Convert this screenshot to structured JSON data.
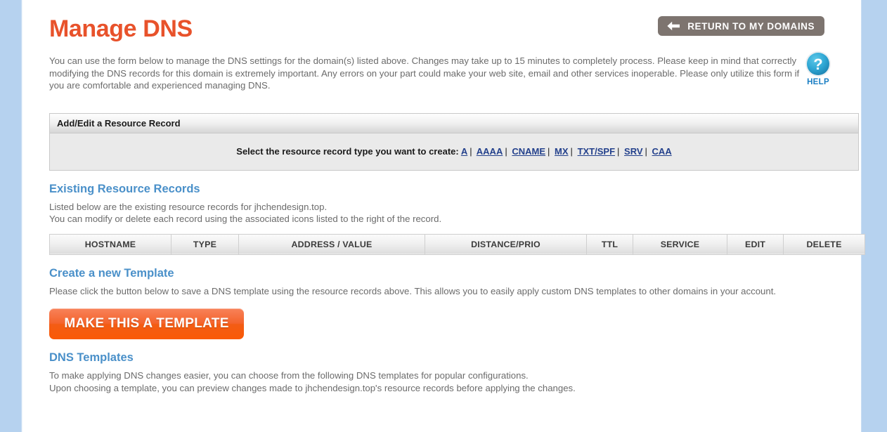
{
  "header": {
    "title": "Manage DNS",
    "return_button": {
      "label": "RETURN TO MY DOMAINS",
      "icon": "left-arrow-icon"
    }
  },
  "intro": {
    "text": "You can use the form below to manage the DNS settings for the domain(s) listed above. Changes may take up to 15 minutes to completely process. Please keep in mind that correctly modifying the DNS records for this domain is extremely important. Any errors on your part could make your web site, email and other services inoperable. Please only utilize this form if you are comfortable and experienced managing DNS.",
    "help": {
      "icon": "question-mark-icon",
      "label": "HELP"
    }
  },
  "add_edit_panel": {
    "heading": "Add/Edit a Resource Record",
    "prompt": "Select the resource record type you want to create:",
    "separator": "|",
    "record_types": [
      "A",
      "AAAA",
      "CNAME",
      "MX",
      "TXT/SPF",
      "SRV",
      "CAA"
    ]
  },
  "existing_records": {
    "title": "Existing Resource Records",
    "desc_line1": "Listed below are the existing resource records for jhchendesign.top.",
    "desc_line2": "You can modify or delete each record using the associated icons listed to the right of the record.",
    "columns": [
      "HOSTNAME",
      "TYPE",
      "ADDRESS / VALUE",
      "DISTANCE/PRIO",
      "TTL",
      "SERVICE",
      "EDIT",
      "DELETE"
    ],
    "rows": []
  },
  "create_template": {
    "title": "Create a new Template",
    "desc": "Please click the button below to save a DNS template using the resource records above. This allows you to easily apply custom DNS templates to other domains in your account.",
    "button_label": "MAKE THIS A TEMPLATE"
  },
  "dns_templates": {
    "title": "DNS Templates",
    "desc_line1": "To make applying DNS changes easier, you can choose from the following DNS templates for popular configurations.",
    "desc_line2": "Upon choosing a template, you can preview changes made to jhchendesign.top's resource records before applying the changes."
  },
  "colors": {
    "title_orange": "#e8522b",
    "heading_blue": "#4a90c9",
    "link_blue": "#24418c",
    "help_blue": "#1b7fc4",
    "button_orange": "#f4642c",
    "return_grey": "#7d746f",
    "page_background": "#b6d2ef"
  }
}
